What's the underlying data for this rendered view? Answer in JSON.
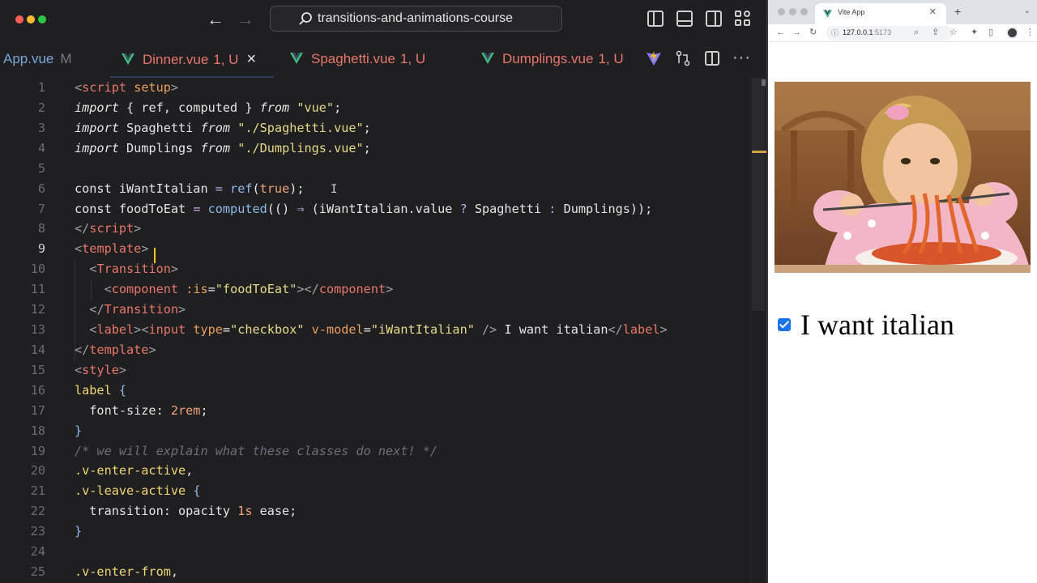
{
  "editor": {
    "search_text": "transitions-and-animations-course",
    "tabs": [
      {
        "file": "App.vue",
        "status": "M"
      },
      {
        "file": "Dinner.vue",
        "status": "1, U"
      },
      {
        "file": "Spaghetti.vue",
        "status": "1, U"
      },
      {
        "file": "Dumplings.vue",
        "status": "1, U"
      }
    ],
    "active_line": 9,
    "lines": [
      {
        "n": "1",
        "tokens": [
          [
            "tk-angle",
            "<"
          ],
          [
            "tk-tag",
            "script"
          ],
          [
            "tk-plain",
            " "
          ],
          [
            "tk-attr",
            "setup"
          ],
          [
            "tk-angle",
            ">"
          ]
        ]
      },
      {
        "n": "2",
        "tokens": [
          [
            "tk-kw",
            "import"
          ],
          [
            "tk-plain",
            " { ref, computed } "
          ],
          [
            "tk-kw",
            "from"
          ],
          [
            "tk-plain",
            " "
          ],
          [
            "tk-str",
            "\"vue\""
          ],
          [
            "tk-plain",
            ";"
          ]
        ]
      },
      {
        "n": "3",
        "tokens": [
          [
            "tk-kw",
            "import"
          ],
          [
            "tk-plain",
            " Spaghetti "
          ],
          [
            "tk-kw",
            "from"
          ],
          [
            "tk-plain",
            " "
          ],
          [
            "tk-str",
            "\"./Spaghetti.vue\""
          ],
          [
            "tk-plain",
            ";"
          ]
        ]
      },
      {
        "n": "4",
        "tokens": [
          [
            "tk-kw",
            "import"
          ],
          [
            "tk-plain",
            " Dumplings "
          ],
          [
            "tk-kw",
            "from"
          ],
          [
            "tk-plain",
            " "
          ],
          [
            "tk-str",
            "\"./Dumplings.vue\""
          ],
          [
            "tk-plain",
            ";"
          ]
        ]
      },
      {
        "n": "5",
        "tokens": []
      },
      {
        "n": "6",
        "tokens": [
          [
            "tk-const",
            "const"
          ],
          [
            "tk-plain",
            " iWantItalian "
          ],
          [
            "tk-op",
            "="
          ],
          [
            "tk-plain",
            " "
          ],
          [
            "tk-fn",
            "ref"
          ],
          [
            "tk-paren",
            "("
          ],
          [
            "tk-num",
            "true"
          ],
          [
            "tk-paren",
            ")"
          ],
          [
            "tk-plain",
            ";"
          ]
        ]
      },
      {
        "n": "7",
        "tokens": [
          [
            "tk-const",
            "const"
          ],
          [
            "tk-plain",
            " foodToEat "
          ],
          [
            "tk-op",
            "="
          ],
          [
            "tk-plain",
            " "
          ],
          [
            "tk-fn",
            "computed"
          ],
          [
            "tk-paren",
            "(() "
          ],
          [
            "tk-op",
            "⇒"
          ],
          [
            "tk-plain",
            " (iWantItalian.value "
          ],
          [
            "tk-op",
            "?"
          ],
          [
            "tk-plain",
            " Spaghetti "
          ],
          [
            "tk-op",
            ":"
          ],
          [
            "tk-plain",
            " Dumplings));"
          ]
        ]
      },
      {
        "n": "8",
        "tokens": [
          [
            "tk-angle",
            "</"
          ],
          [
            "tk-tag",
            "script"
          ],
          [
            "tk-angle",
            ">"
          ]
        ]
      },
      {
        "n": "9",
        "tokens": [
          [
            "tk-angle",
            "<"
          ],
          [
            "tk-tag",
            "template"
          ],
          [
            "tk-angle",
            ">"
          ]
        ]
      },
      {
        "n": "10",
        "tokens": [
          [
            "tk-plain",
            "  "
          ],
          [
            "tk-angle",
            "<"
          ],
          [
            "tk-tag",
            "Transition"
          ],
          [
            "tk-angle",
            ">"
          ]
        ]
      },
      {
        "n": "11",
        "tokens": [
          [
            "tk-plain",
            "    "
          ],
          [
            "tk-angle",
            "<"
          ],
          [
            "tk-tag",
            "component"
          ],
          [
            "tk-plain",
            " "
          ],
          [
            "tk-attr",
            ":is"
          ],
          [
            "tk-plain",
            "="
          ],
          [
            "tk-str",
            "\"foodToEat\""
          ],
          [
            "tk-angle",
            "></"
          ],
          [
            "tk-tag",
            "component"
          ],
          [
            "tk-angle",
            ">"
          ]
        ]
      },
      {
        "n": "12",
        "tokens": [
          [
            "tk-plain",
            "  "
          ],
          [
            "tk-angle",
            "</"
          ],
          [
            "tk-tag",
            "Transition"
          ],
          [
            "tk-angle",
            ">"
          ]
        ]
      },
      {
        "n": "13",
        "tokens": [
          [
            "tk-plain",
            "  "
          ],
          [
            "tk-angle",
            "<"
          ],
          [
            "tk-tag",
            "label"
          ],
          [
            "tk-angle",
            "><"
          ],
          [
            "tk-tag",
            "input"
          ],
          [
            "tk-plain",
            " "
          ],
          [
            "tk-attr",
            "type"
          ],
          [
            "tk-plain",
            "="
          ],
          [
            "tk-str",
            "\"checkbox\""
          ],
          [
            "tk-plain",
            " "
          ],
          [
            "tk-attr",
            "v-model"
          ],
          [
            "tk-plain",
            "="
          ],
          [
            "tk-str",
            "\"iWantItalian\""
          ],
          [
            "tk-plain",
            " "
          ],
          [
            "tk-angle",
            "/>"
          ],
          [
            "tk-plain",
            " I want italian"
          ],
          [
            "tk-angle",
            "</"
          ],
          [
            "tk-tag",
            "label"
          ],
          [
            "tk-angle",
            ">"
          ]
        ]
      },
      {
        "n": "14",
        "tokens": [
          [
            "tk-angle",
            "</"
          ],
          [
            "tk-tag",
            "template"
          ],
          [
            "tk-angle",
            ">"
          ]
        ]
      },
      {
        "n": "15",
        "tokens": [
          [
            "tk-angle",
            "<"
          ],
          [
            "tk-tag",
            "style"
          ],
          [
            "tk-angle",
            ">"
          ]
        ]
      },
      {
        "n": "16",
        "tokens": [
          [
            "tk-sel",
            "label"
          ],
          [
            "tk-plain",
            " "
          ],
          [
            "tk-brace",
            "{"
          ]
        ]
      },
      {
        "n": "17",
        "tokens": [
          [
            "tk-plain",
            "  font-size: "
          ],
          [
            "tk-num",
            "2rem"
          ],
          [
            "tk-plain",
            ";"
          ]
        ]
      },
      {
        "n": "18",
        "tokens": [
          [
            "tk-brace",
            "}"
          ]
        ]
      },
      {
        "n": "19",
        "tokens": [
          [
            "tk-cmt",
            "/* we will explain what these classes do next! */"
          ]
        ]
      },
      {
        "n": "20",
        "tokens": [
          [
            "tk-sel",
            ".v-enter-active"
          ],
          [
            "tk-plain",
            ","
          ]
        ]
      },
      {
        "n": "21",
        "tokens": [
          [
            "tk-sel",
            ".v-leave-active"
          ],
          [
            "tk-plain",
            " "
          ],
          [
            "tk-brace",
            "{"
          ]
        ]
      },
      {
        "n": "22",
        "tokens": [
          [
            "tk-plain",
            "  transition: opacity "
          ],
          [
            "tk-num",
            "1s"
          ],
          [
            "tk-plain",
            " ease;"
          ]
        ]
      },
      {
        "n": "23",
        "tokens": [
          [
            "tk-brace",
            "}"
          ]
        ]
      },
      {
        "n": "24",
        "tokens": []
      },
      {
        "n": "25",
        "tokens": [
          [
            "tk-sel",
            ".v-enter-from"
          ],
          [
            "tk-plain",
            ","
          ]
        ]
      }
    ]
  },
  "browser": {
    "tab_title": "Vite App",
    "url_host": "127.0.0.1",
    "url_port": ":5173",
    "checkbox_checked": true,
    "label_text": "I want italian"
  },
  "colors": {
    "vue_green": "#41b883",
    "untracked_red": "#e8776a",
    "accent_cursor": "#f5c518"
  }
}
